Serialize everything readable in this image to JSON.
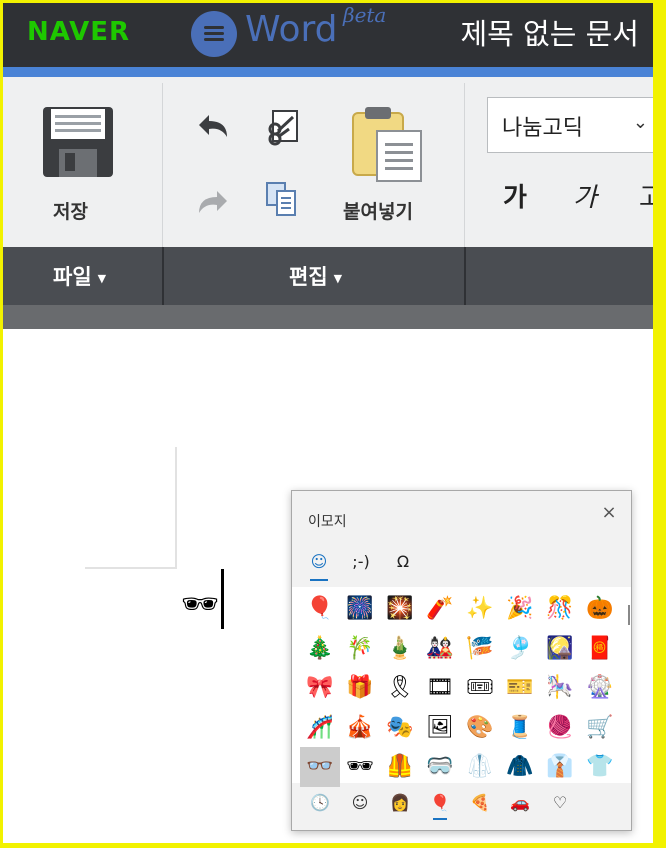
{
  "header": {
    "naver_logo": "NAVER",
    "app_name": "Word",
    "beta": "βeta",
    "doc_title": "제목 없는 문서"
  },
  "ribbon": {
    "save_label": "저장",
    "paste_label": "붙여넣기",
    "font_name": "나눔고딕",
    "bold_glyph": "가",
    "italic_glyph": "가",
    "third_glyph": "고",
    "groups": [
      "파일",
      "편집"
    ]
  },
  "document": {
    "typed_emoji": "🕶"
  },
  "emoji_panel": {
    "title": "이모지",
    "close_glyph": "×",
    "tabs": [
      "☺",
      ";-)",
      "Ω"
    ],
    "emojis": [
      [
        "🎈",
        "🎆",
        "🎇",
        "🧨",
        "✨",
        "🎉",
        "🎊",
        "🎃"
      ],
      [
        "🎄",
        "🎋",
        "🎍",
        "🎎",
        "🎏",
        "🎐",
        "🎑",
        "🧧"
      ],
      [
        "🎀",
        "🎁",
        "🎗",
        "🎞",
        "🎟",
        "🎫",
        "🎠",
        "🎡"
      ],
      [
        "🎢",
        "🎪",
        "🎭",
        "🖼",
        "🎨",
        "🧵",
        "🧶",
        "🛒"
      ],
      [
        "👓",
        "🕶",
        "🦺",
        "🥽",
        "🥼",
        "🧥",
        "👔",
        "👕"
      ]
    ],
    "categories": [
      "🕓",
      "☺",
      "👩",
      "🎈",
      "🍕",
      "🚗",
      "♡"
    ]
  }
}
